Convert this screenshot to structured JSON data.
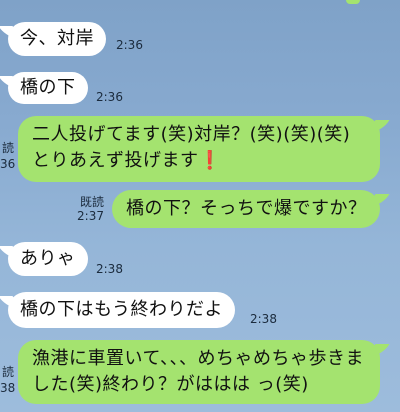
{
  "messages": [
    {
      "side": "left",
      "text": "今、対岸",
      "time": "2:36"
    },
    {
      "side": "left",
      "text": "橋の下",
      "time": "2:36"
    },
    {
      "side": "right",
      "text": "二人投げてます(笑)対岸？(笑)(笑)(笑)とりあえず投げます",
      "mark": "❗",
      "read": "読",
      "time": "36"
    },
    {
      "side": "right",
      "text": "橋の下？そっちで爆ですか？",
      "read": "既読",
      "time": "2:37"
    },
    {
      "side": "left",
      "text": "ありゃ",
      "time": "2:38"
    },
    {
      "side": "left",
      "text": "橋の下はもう終わりだよ",
      "time": "2:38"
    },
    {
      "side": "right",
      "text": "漁港に車置いて、、、めちゃめちゃ歩きました(笑)終わり？がははは っ(笑)",
      "read": "読",
      "time": "38"
    }
  ],
  "colors": {
    "own_bubble": "#a4e36f",
    "other_bubble": "#ffffff",
    "exclamation": "#e12c20",
    "background": "#88aad0"
  }
}
